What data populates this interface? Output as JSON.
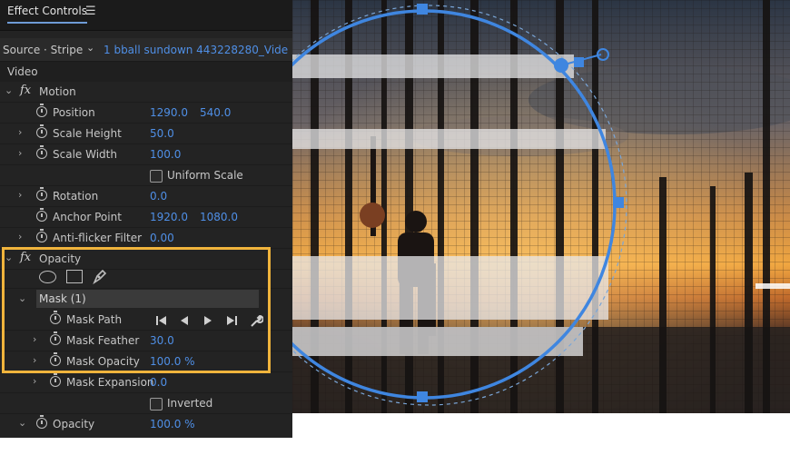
{
  "panel": {
    "title": "Effect Controls",
    "menu_glyph": "☰",
    "source_label": "Source · Stripe",
    "source_clip": "1 bball sundown 443228280_Vide...",
    "video_label": "Video"
  },
  "motion": {
    "label": "Motion",
    "position": {
      "label": "Position",
      "x": "1290.0",
      "y": "540.0"
    },
    "scale_height": {
      "label": "Scale Height",
      "value": "50.0"
    },
    "scale_width": {
      "label": "Scale Width",
      "value": "100.0"
    },
    "uniform_scale": {
      "label": "Uniform Scale",
      "checked": false
    },
    "rotation": {
      "label": "Rotation",
      "value": "0.0"
    },
    "anchor_point": {
      "label": "Anchor Point",
      "x": "1920.0",
      "y": "1080.0"
    },
    "anti_flicker": {
      "label": "Anti-flicker Filter",
      "value": "0.00"
    }
  },
  "opacity_effect": {
    "label": "Opacity",
    "mask": {
      "label": "Mask (1)",
      "path_label": "Mask Path",
      "feather": {
        "label": "Mask Feather",
        "value": "30.0"
      },
      "opacity": {
        "label": "Mask Opacity",
        "value": "100.0 %"
      },
      "expansion": {
        "label": "Mask Expansion",
        "value": "0.0"
      },
      "inverted": {
        "label": "Inverted",
        "checked": false
      }
    },
    "opacity": {
      "label": "Opacity",
      "value": "100.0 %"
    }
  },
  "colors": {
    "accent_blue": "#4f8fe6",
    "highlight_orange": "#f0b43c",
    "mask_outline": "#3f86e0",
    "panel_bg": "#232323"
  },
  "icons": [
    "menu-icon",
    "chevron-down-icon",
    "chevron-right-icon",
    "fx-icon",
    "stopwatch-icon",
    "ellipse-mask-icon",
    "rectangle-mask-icon",
    "pen-mask-icon",
    "track-backward-icon",
    "step-backward-icon",
    "play-forward-icon",
    "track-forward-icon",
    "wrench-icon"
  ]
}
